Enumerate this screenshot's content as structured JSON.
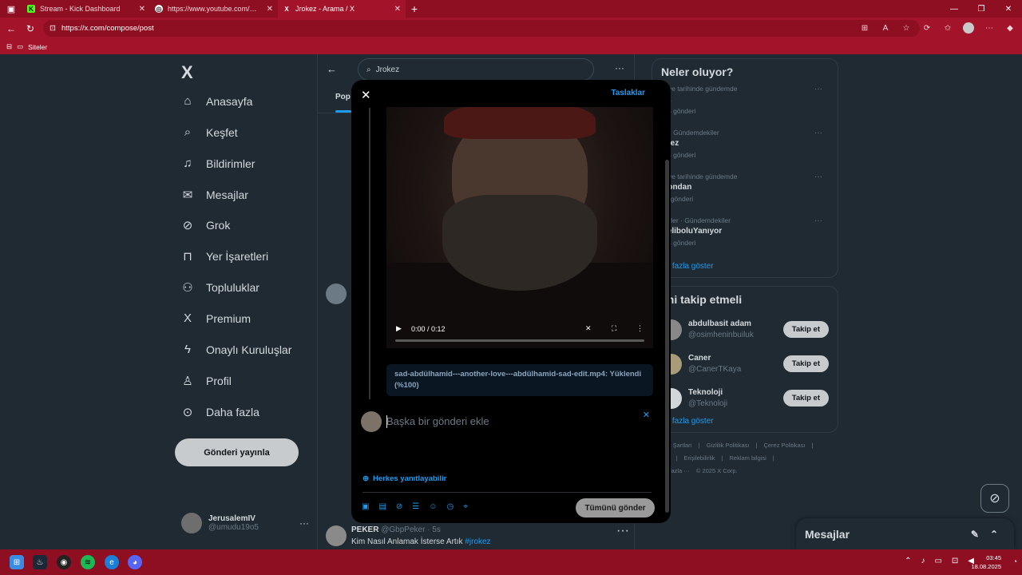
{
  "browser": {
    "tabs": [
      {
        "label": "Stream - Kick Dashboard",
        "favicon": "K",
        "color": "#53fc18"
      },
      {
        "label": "https://www.youtube.com/watch?v=...",
        "favicon": "◎",
        "color": "#ffffff"
      },
      {
        "label": "Jrokez - Arama / X",
        "favicon": "X",
        "color": "#ffffff",
        "active": true
      }
    ],
    "new_tab": "+",
    "url": "https://x.com/compose/post",
    "bookmark_folder": "Siteler"
  },
  "sidebar": {
    "logo": "X",
    "items": [
      {
        "label": "Anasayfa",
        "icon": "home-icon",
        "glyph": "⌂"
      },
      {
        "label": "Keşfet",
        "icon": "search-icon",
        "glyph": "⌕"
      },
      {
        "label": "Bildirimler",
        "icon": "bell-icon",
        "glyph": "⍾"
      },
      {
        "label": "Mesajlar",
        "icon": "mail-icon",
        "glyph": "✉"
      },
      {
        "label": "Grok",
        "icon": "grok-icon",
        "glyph": "⌀"
      },
      {
        "label": "Yer İşaretleri",
        "icon": "bookmark-icon",
        "glyph": "☐"
      },
      {
        "label": "Topluluklar",
        "icon": "communities-icon",
        "glyph": "⚇"
      },
      {
        "label": "Premium",
        "icon": "x-premium-icon",
        "glyph": "X"
      },
      {
        "label": "Onaylı Kuruluşlar",
        "icon": "lightning-icon",
        "glyph": "⚡"
      },
      {
        "label": "Profil",
        "icon": "person-icon",
        "glyph": "☺"
      },
      {
        "label": "Daha fazla",
        "icon": "more-circle-icon",
        "glyph": "⋯"
      }
    ],
    "post_button": "Gönderi yayınla",
    "account": {
      "name": "JerusalemIV",
      "handle": "@umudu19o5"
    }
  },
  "feed": {
    "search_value": "Jrokez",
    "tab": "Pop",
    "tweet": {
      "name": "PEKER",
      "handle": "@GbpPeker",
      "time": "· 5s",
      "text": "Kim Nasıl Anlamak İsterse Artık",
      "hashtag": "#jrokez"
    }
  },
  "right": {
    "trends_title": "Neler oluyor?",
    "trends": [
      {
        "category": "rkiye tarihinde gündemde",
        "name": "fat",
        "count": "2 B gönderi"
      },
      {
        "category": "or · Gündemdekiler",
        "name": "okez",
        "count": "7 B gönderi"
      },
      {
        "category": "rkiye tarihinde gündemde",
        "name": "lkondan",
        "count": "08 gönderi"
      },
      {
        "category": "berler · Gündemdekiler",
        "name": "GeliboluYanıyor",
        "count": "5 B gönderi"
      }
    ],
    "trends_more": "ha fazla göster",
    "follow_title": "imi takip etmeli",
    "follow": [
      {
        "name": "abdulbasit adam",
        "handle": "@osimheninbuiluk",
        "button": "Takip et"
      },
      {
        "name": "Caner",
        "handle": "@CanerTKaya",
        "button": "Takip et"
      },
      {
        "name": "Teknoloji",
        "handle": "@Teknoloji",
        "button": "Takip et"
      }
    ],
    "follow_more": "ha fazla göster",
    "footer": [
      "met Şartları",
      "|",
      "Gizlilik Politikası",
      "|",
      "Çerez Politikası",
      "|",
      "rint",
      "|",
      "Erişilebilirlik",
      "|",
      "Reklam bilgisi",
      "|",
      "ha fazla ···",
      "© 2025 X Corp."
    ]
  },
  "messages_drawer": {
    "title": "Mesajlar"
  },
  "modal": {
    "drafts": "Taslaklar",
    "video": {
      "time": "0:00 / 0:12"
    },
    "upload_text": "sad-abdülhamid---another-love---abdülhamid-sad-edit.mp4: Yüklendi (%100)",
    "reply_placeholder": "Başka bir gönderi ekle",
    "reply_audience": "Herkes yanıtlayabilir",
    "send_all": "Tümünü gönder",
    "tools": [
      "image-icon",
      "gif-icon",
      "grok-icon",
      "poll-icon",
      "emoji-icon",
      "schedule-icon",
      "location-icon"
    ]
  },
  "taskbar": {
    "time": "03:45",
    "date": "18.08.2025"
  }
}
